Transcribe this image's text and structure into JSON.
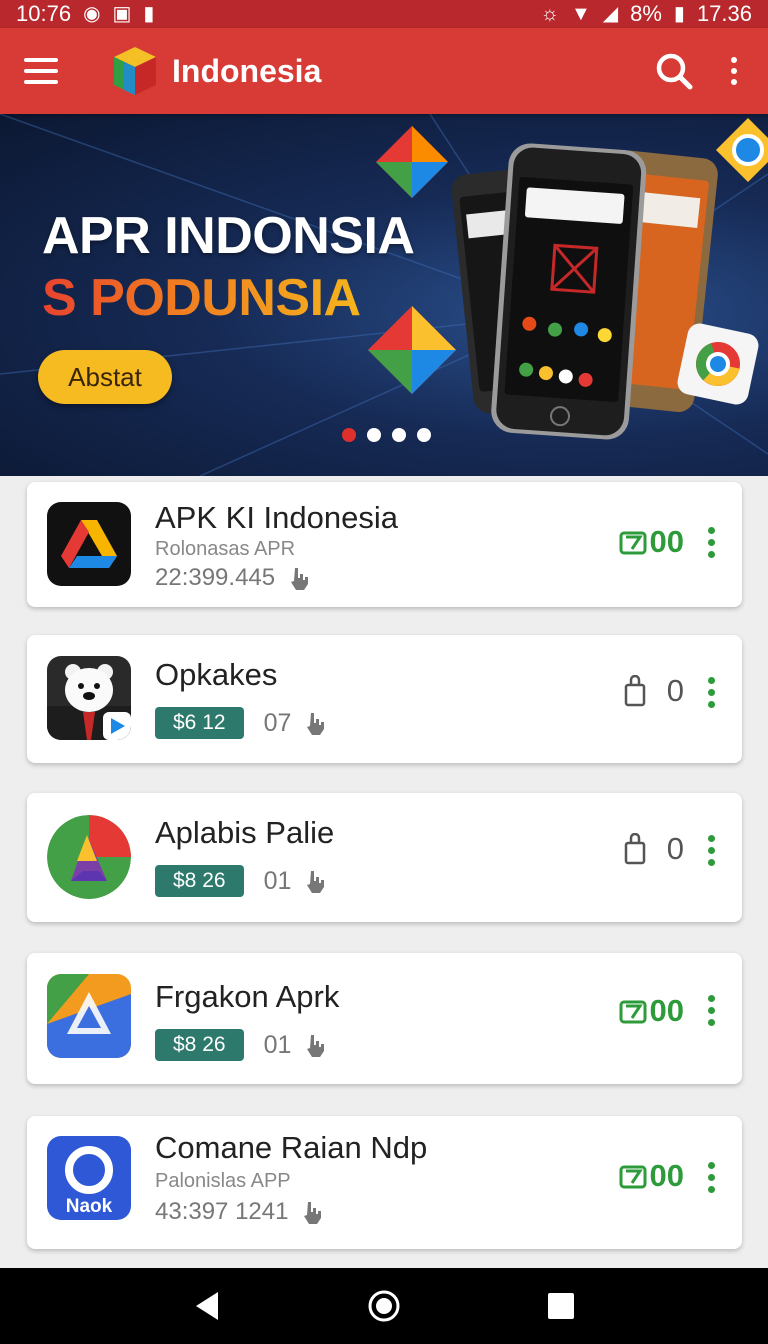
{
  "status_bar": {
    "time_left": "10:76",
    "battery": "8%",
    "time_right": "17.36"
  },
  "app_bar": {
    "title": "Indonesia"
  },
  "banner": {
    "title_line1": "APR INDONSIA",
    "title_line2": "S PODUNSIA",
    "cta_label": "Abstat",
    "carousel": {
      "total": 4,
      "active": 1
    }
  },
  "apps": [
    {
      "name": "APK KI Indonesia",
      "subtitle": "Rolonasas APR",
      "stats": "22:399.445",
      "action": "00",
      "action_type": "download",
      "icon": "drive-dark-icon"
    },
    {
      "name": "Opkakes",
      "price": "$6 12",
      "count": "07",
      "action": "0",
      "action_type": "bag",
      "icon": "bear-icon"
    },
    {
      "name": "Aplabis Palie",
      "price": "$8 26",
      "count": "01",
      "action": "0",
      "action_type": "bag",
      "icon": "drive-green-icon"
    },
    {
      "name": "Frgakon Aprk",
      "price": "$8 26",
      "count": "01",
      "action": "00",
      "action_type": "download",
      "icon": "drive-blue-icon"
    },
    {
      "name": "Comane Raian Ndp",
      "subtitle": "Palonislas APP",
      "stats": "43:397 1241",
      "action": "00",
      "action_type": "download",
      "icon": "naok-icon"
    }
  ],
  "icon_labels": {
    "naok": "Naok"
  },
  "colors": {
    "app_bar": "#d83b36",
    "accent_green": "#2e9b3a",
    "badge": "#2d7a6c",
    "cta": "#f7bb22"
  }
}
